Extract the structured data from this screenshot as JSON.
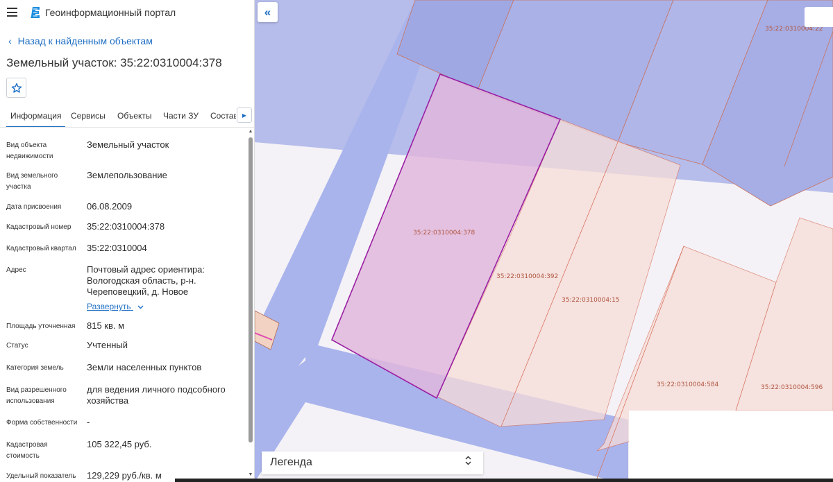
{
  "header": {
    "app_title": "Геоинформационный портал",
    "menu_icon": "hamburger-menu-icon",
    "logo_icon": "portal-logo-icon"
  },
  "navigation": {
    "back_label": "Назад к найденным объектам"
  },
  "object": {
    "title": "Земельный участок: 35:22:0310004:378"
  },
  "tabs": [
    {
      "label": "Информация",
      "active": true
    },
    {
      "label": "Сервисы",
      "active": false
    },
    {
      "label": "Объекты",
      "active": false
    },
    {
      "label": "Части ЗУ",
      "active": false
    },
    {
      "label": "Состав",
      "active": false
    }
  ],
  "properties": [
    {
      "label": "Вид объекта недвижимости",
      "value": "Земельный участок"
    },
    {
      "label": "Вид земельного участка",
      "value": "Землепользование"
    },
    {
      "label": "Дата присвоения",
      "value": "06.08.2009"
    },
    {
      "label": "Кадастровый номер",
      "value": "35:22:0310004:378"
    },
    {
      "label": "Кадастровый квартал",
      "value": "35:22:0310004"
    },
    {
      "label": "Адрес",
      "value": "Почтовый адрес ориентира: Вологодская область, р-н. Череповецкий, д. Новое"
    },
    {
      "label": "Площадь уточненная",
      "value": "815 кв. м"
    },
    {
      "label": "Статус",
      "value": "Учтенный"
    },
    {
      "label": "Категория земель",
      "value": "Земли населенных пунктов"
    },
    {
      "label": "Вид разрешенного использования",
      "value": "для ведения личного подсобного хозяйства"
    },
    {
      "label": "Форма собственности",
      "value": "-"
    },
    {
      "label": "Кадастровая стоимость",
      "value": "105 322,45 руб."
    },
    {
      "label": "Удельный показатель",
      "value": "129,229 руб./кв. м"
    }
  ],
  "expand_label": "Развернуть",
  "map": {
    "collapse_icon": "double-chevron-left-icon",
    "legend_label": "Легенда",
    "legend_toggle_icon": "expand-collapse-icon",
    "colors": {
      "selected_parcel_fill": "#e0b6dc",
      "selected_parcel_stroke": "#9b1fa3",
      "parcel_fill": "#f7ddd8",
      "parcel_stroke": "#d9735f",
      "road_blue": "#a9b4ec",
      "block_blue": "#b6bdeb"
    },
    "parcel_labels": [
      "35:22:0310004:22",
      "35:22:0310004:378",
      "35:22:0310004:392",
      "35:22:0310004:15",
      "35:22:0310004:584",
      "35:22:0310004:596"
    ]
  }
}
